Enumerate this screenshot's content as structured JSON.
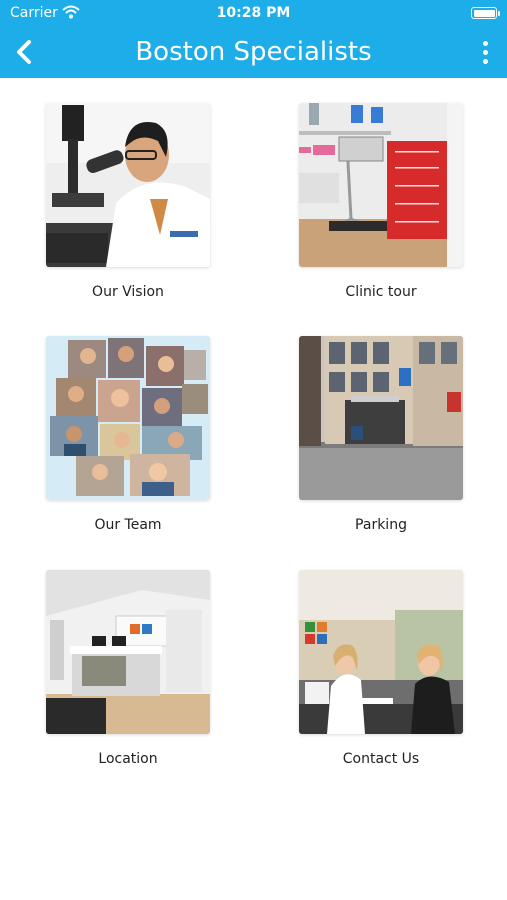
{
  "status_bar": {
    "carrier": "Carrier",
    "time": "10:28 PM"
  },
  "header": {
    "title": "Boston Specialists",
    "back_icon": "chevron-left-icon",
    "menu_icon": "more-vertical-icon"
  },
  "colors": {
    "header_bg": "#1DADE8",
    "clinic_drawers": "#D72A2A"
  },
  "tiles": [
    {
      "label": "Our Vision",
      "image": "doctor-microscope-photo"
    },
    {
      "label": "Clinic tour",
      "image": "clinic-equipment-photo"
    },
    {
      "label": "Our Team",
      "image": "team-collage-photo"
    },
    {
      "label": "Parking",
      "image": "parking-garage-photo"
    },
    {
      "label": "Location",
      "image": "reception-lobby-photo"
    },
    {
      "label": "Contact Us",
      "image": "front-desk-photo"
    }
  ]
}
